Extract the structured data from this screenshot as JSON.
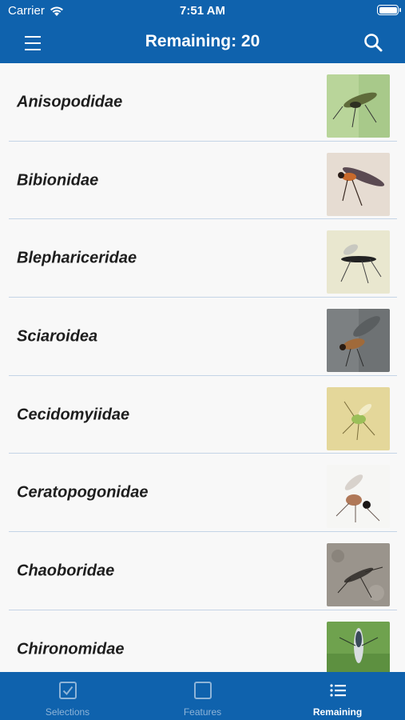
{
  "status_bar": {
    "carrier": "Carrier",
    "time": "7:51 AM"
  },
  "nav": {
    "title": "Remaining: 20"
  },
  "families": [
    {
      "name": "Anisopodidae",
      "image": "insect-photo"
    },
    {
      "name": "Bibionidae",
      "image": "insect-photo"
    },
    {
      "name": "Blephariceridae",
      "image": "insect-photo"
    },
    {
      "name": "Sciaroidea",
      "image": "insect-photo"
    },
    {
      "name": "Cecidomyiidae",
      "image": "insect-photo"
    },
    {
      "name": "Ceratopogonidae",
      "image": "insect-photo"
    },
    {
      "name": "Chaoboridae",
      "image": "insect-photo"
    },
    {
      "name": "Chironomidae",
      "image": "insect-photo"
    }
  ],
  "tabs": [
    {
      "label": "Selections",
      "icon": "checked-square-icon",
      "active": false
    },
    {
      "label": "Features",
      "icon": "square-icon",
      "active": false
    },
    {
      "label": "Remaining",
      "icon": "list-icon",
      "active": true
    }
  ],
  "colors": {
    "brand": "#0f62ad",
    "list_bg": "#f8f8f8",
    "separator": "#c4d4e6",
    "inactive_tab": "#8eb4d8"
  }
}
